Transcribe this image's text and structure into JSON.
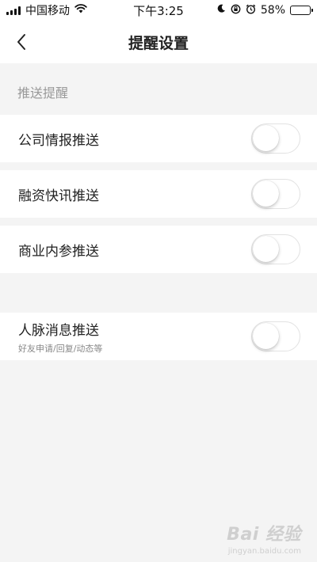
{
  "status_bar": {
    "carrier": "中国移动",
    "time": "下午3:25",
    "battery": "58%",
    "battery_level": 0.58,
    "icons": [
      "signal-icon",
      "wifi-icon",
      "moon-icon",
      "orientation-lock-icon",
      "alarm-icon",
      "battery-icon"
    ]
  },
  "nav": {
    "title": "提醒设置",
    "back_icon": "chevron-left-icon"
  },
  "section": {
    "header": "推送提醒"
  },
  "settings": [
    {
      "label": "公司情报推送",
      "sublabel": "",
      "enabled": false
    },
    {
      "label": "融资快讯推送",
      "sublabel": "",
      "enabled": false
    },
    {
      "label": "商业内参推送",
      "sublabel": "",
      "enabled": false
    },
    {
      "label": "人脉消息推送",
      "sublabel": "好友申请/回复/动态等",
      "enabled": false
    }
  ],
  "watermark": {
    "brand": "Bai 经验",
    "sub": "jingyan.baidu.com"
  },
  "colors": {
    "background": "#f4f4f4",
    "card": "#ffffff",
    "text": "#222222",
    "muted": "#999999",
    "toggle_border": "#e2e2e2"
  }
}
